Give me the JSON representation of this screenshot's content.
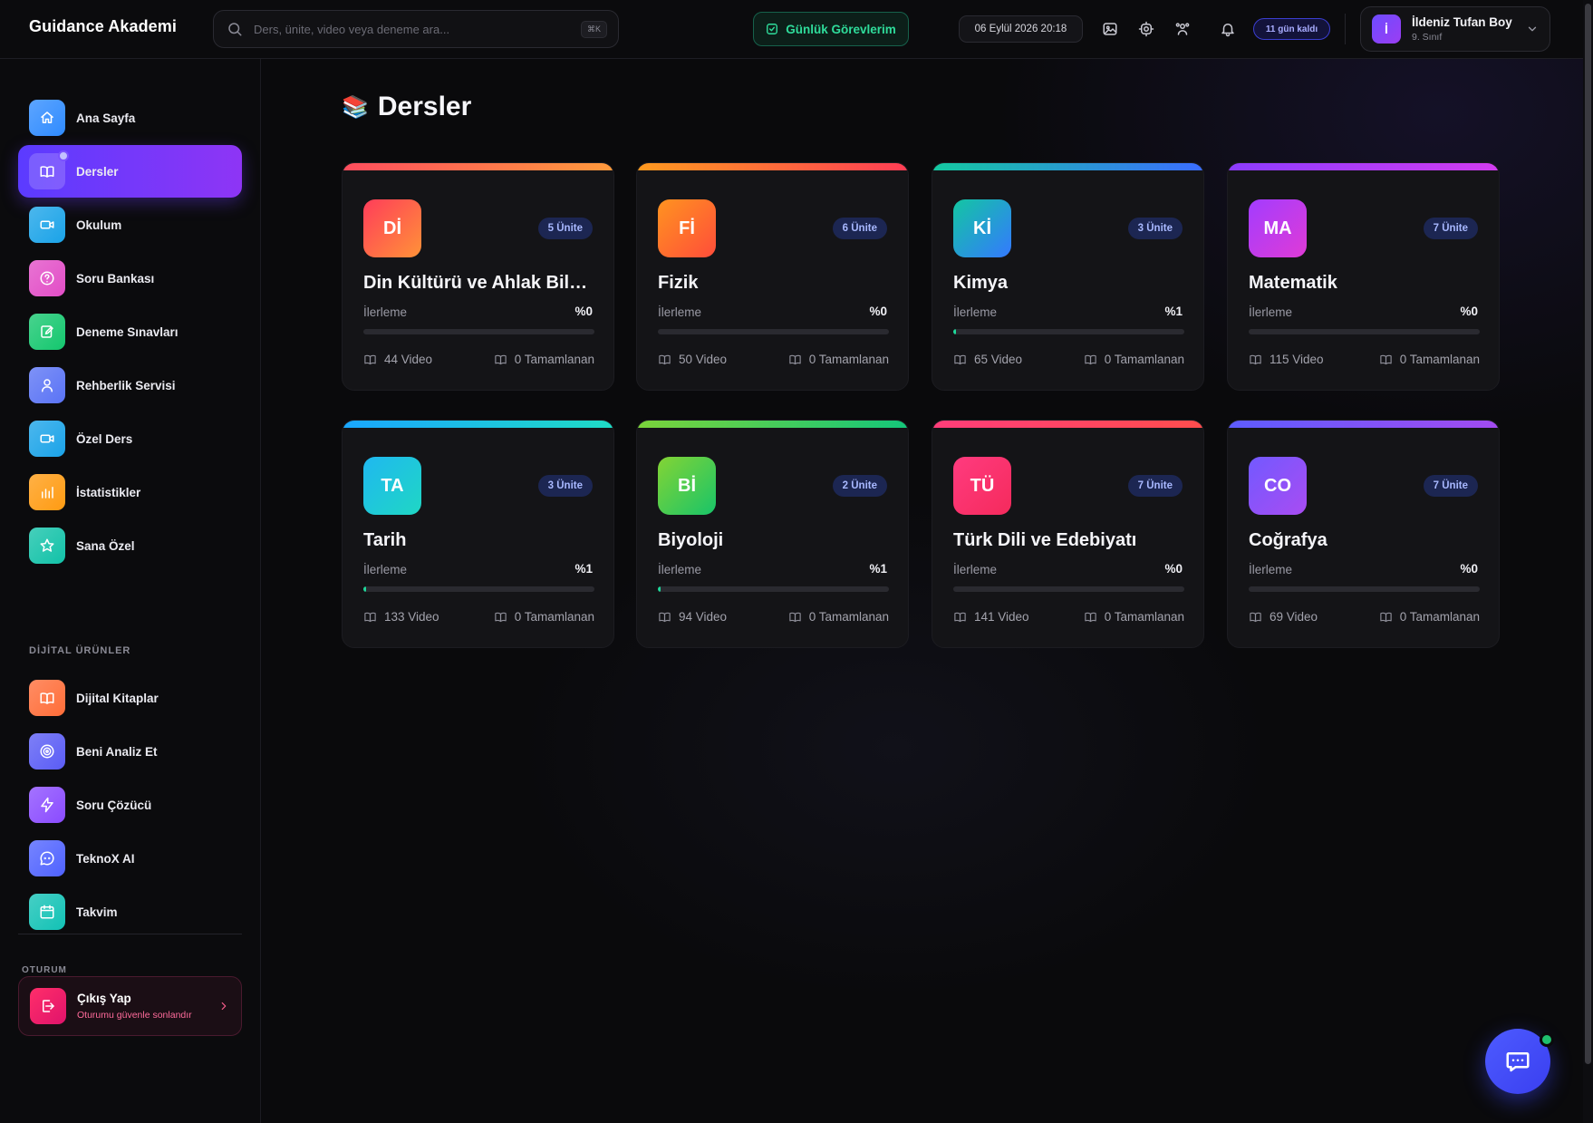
{
  "header": {
    "brand": "Guidance Akademi",
    "search_placeholder": "Ders, ünite, video veya deneme ara...",
    "search_shortcut": "⌘K",
    "tasks_label": "Günlük Görevlerim",
    "datetime": "06 Eylül 2026 20:18",
    "days_left": "11 gün kaldı",
    "user": {
      "initial": "İ",
      "name": "İldeniz Tufan Boy",
      "grade": "9. Sınıf"
    }
  },
  "sidebar": {
    "items": [
      {
        "label": "Ana Sayfa",
        "icon": "home-icon",
        "color": "#2f8bff"
      },
      {
        "label": "Dersler",
        "icon": "book-open-icon",
        "color": "#7a3cff",
        "active": true
      },
      {
        "label": "Okulum",
        "icon": "video-camera-icon",
        "color": "#1aa3e8"
      },
      {
        "label": "Soru Bankası",
        "icon": "question-circle-icon",
        "color": "#e24dc6"
      },
      {
        "label": "Deneme Sınavları",
        "icon": "edit-icon",
        "color": "#14c76e"
      },
      {
        "label": "Rehberlik Servisi",
        "icon": "user-icon",
        "color": "#5a73f5"
      },
      {
        "label": "Özel Ders",
        "icon": "video-camera-icon",
        "color": "#1aa3e8"
      },
      {
        "label": "İstatistikler",
        "icon": "bar-chart-icon",
        "color": "#ff9b12"
      },
      {
        "label": "Sana Özel",
        "icon": "star-icon",
        "color": "#12c2a8"
      }
    ],
    "digital_title": "DİJİTAL ÜRÜNLER",
    "digital_items": [
      {
        "label": "Dijital Kitaplar",
        "icon": "book-open-icon",
        "color": "#ff6d38"
      },
      {
        "label": "Beni Analiz Et",
        "icon": "target-icon",
        "color": "#5a5cf5"
      },
      {
        "label": "Soru Çözücü",
        "icon": "lightning-icon",
        "color": "#8a4bff"
      },
      {
        "label": "TeknoX AI",
        "icon": "chat-bubble-icon",
        "color": "#4f62ff"
      },
      {
        "label": "Takvim",
        "icon": "calendar-icon",
        "color": "#12c2b5"
      }
    ],
    "session_title": "OTURUM",
    "logout": {
      "title": "Çıkış Yap",
      "subtitle": "Oturumu güvenle sonlandır"
    }
  },
  "main": {
    "title_emoji": "📚",
    "title": "Dersler",
    "progress_label": "İlerleme",
    "completed_suffix": "Tamamlanan",
    "courses": [
      {
        "abbr": "Dİ",
        "name": "Din Kültürü ve Ahlak Bilgisi",
        "units": "5 Ünite",
        "progress": 0,
        "progress_text": "%0",
        "videos": "44 Video",
        "completed": "0 Tamamlanan",
        "bar": [
          "#ff4d5e",
          "#ff9a3c"
        ],
        "grad": [
          "#ff3d5a",
          "#ff9238"
        ]
      },
      {
        "abbr": "Fİ",
        "name": "Fizik",
        "units": "6 Ünite",
        "progress": 0,
        "progress_text": "%0",
        "videos": "50 Video",
        "completed": "0 Tamamlanan",
        "bar": [
          "#ff9a1f",
          "#ff3d55"
        ],
        "grad": [
          "#ff9320",
          "#ff4d3a"
        ]
      },
      {
        "abbr": "Kİ",
        "name": "Kimya",
        "units": "3 Ünite",
        "progress": 1,
        "progress_text": "%1",
        "videos": "65 Video",
        "completed": "0 Tamamlanan",
        "bar": [
          "#14c9a0",
          "#3b6dff"
        ],
        "grad": [
          "#13c6a2",
          "#3479ff"
        ]
      },
      {
        "abbr": "MA",
        "name": "Matematik",
        "units": "7 Ünite",
        "progress": 0,
        "progress_text": "%0",
        "videos": "115 Video",
        "completed": "0 Tamamlanan",
        "bar": [
          "#8c3cff",
          "#d23cf0"
        ],
        "grad": [
          "#a23cff",
          "#e03bd6"
        ]
      },
      {
        "abbr": "TA",
        "name": "Tarih",
        "units": "3 Ünite",
        "progress": 1,
        "progress_text": "%1",
        "videos": "133 Video",
        "completed": "0 Tamamlanan",
        "bar": [
          "#1aa6ff",
          "#1fdcc5"
        ],
        "grad": [
          "#1fb8f0",
          "#1fd7c4"
        ]
      },
      {
        "abbr": "Bİ",
        "name": "Biyoloji",
        "units": "2 Ünite",
        "progress": 1,
        "progress_text": "%1",
        "videos": "94 Video",
        "completed": "0 Tamamlanan",
        "bar": [
          "#7bd33a",
          "#14c67a"
        ],
        "grad": [
          "#84d434",
          "#18c469"
        ]
      },
      {
        "abbr": "TÜ",
        "name": "Türk Dili ve Edebiyatı",
        "units": "7 Ünite",
        "progress": 0,
        "progress_text": "%0",
        "videos": "141 Video",
        "completed": "0 Tamamlanan",
        "bar": [
          "#ff3d7a",
          "#ff4d4d"
        ],
        "grad": [
          "#ff3b7f",
          "#f52a5c"
        ]
      },
      {
        "abbr": "CO",
        "name": "Coğrafya",
        "units": "7 Ünite",
        "progress": 0,
        "progress_text": "%0",
        "videos": "69 Video",
        "completed": "0 Tamamlanan",
        "bar": [
          "#5d5cff",
          "#a34bf0"
        ],
        "grad": [
          "#7259ff",
          "#a94cf2"
        ]
      }
    ]
  }
}
